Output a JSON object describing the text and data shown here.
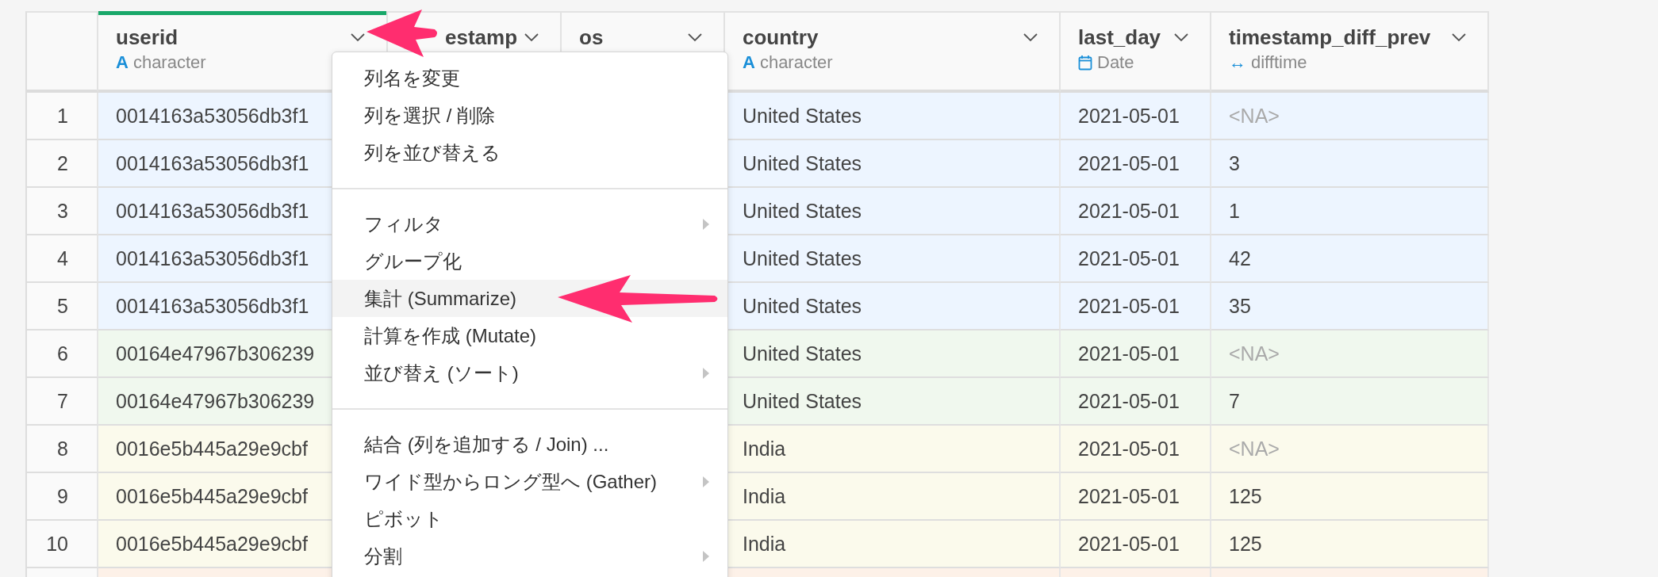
{
  "columns": [
    {
      "name": "userid",
      "selected": true,
      "type": {
        "kind": "char",
        "glyph": "A",
        "label": "character"
      }
    },
    {
      "name": "estamp",
      "selected": false
    },
    {
      "name": "os",
      "selected": false
    },
    {
      "name": "country",
      "selected": false,
      "type": {
        "kind": "char",
        "glyph": "A",
        "label": "character"
      }
    },
    {
      "name": "last_day",
      "selected": false,
      "type": {
        "kind": "date",
        "label": "Date"
      }
    },
    {
      "name": "timestamp_diff_prev",
      "selected": false,
      "type": {
        "kind": "diff",
        "glyph": "↔",
        "label": "difftime"
      }
    }
  ],
  "rows": [
    {
      "number": "1",
      "color": "#edf5ff",
      "cells": [
        {
          "text": "0014163a53056db3f1"
        },
        {},
        {},
        {
          "text": "United States"
        },
        {
          "text": "2021-05-01"
        },
        {
          "text": "<NA>",
          "missing": true
        }
      ]
    },
    {
      "number": "2",
      "color": "#edf5ff",
      "cells": [
        {
          "text": "0014163a53056db3f1"
        },
        {},
        {},
        {
          "text": "United States"
        },
        {
          "text": "2021-05-01"
        },
        {
          "text": "3",
          "missing": false
        }
      ]
    },
    {
      "number": "3",
      "color": "#edf5ff",
      "cells": [
        {
          "text": "0014163a53056db3f1"
        },
        {},
        {},
        {
          "text": "United States"
        },
        {
          "text": "2021-05-01"
        },
        {
          "text": "1",
          "missing": false
        }
      ]
    },
    {
      "number": "4",
      "color": "#edf5ff",
      "cells": [
        {
          "text": "0014163a53056db3f1"
        },
        {},
        {},
        {
          "text": "United States"
        },
        {
          "text": "2021-05-01"
        },
        {
          "text": "42",
          "missing": false
        }
      ]
    },
    {
      "number": "5",
      "color": "#edf5ff",
      "cells": [
        {
          "text": "0014163a53056db3f1"
        },
        {},
        {},
        {
          "text": "United States"
        },
        {
          "text": "2021-05-01"
        },
        {
          "text": "35",
          "missing": false
        }
      ]
    },
    {
      "number": "6",
      "color": "#f0f8ee",
      "cells": [
        {
          "text": "00164e47967b306239"
        },
        {},
        {},
        {
          "text": "United States"
        },
        {
          "text": "2021-05-01"
        },
        {
          "text": "<NA>",
          "missing": true
        }
      ]
    },
    {
      "number": "7",
      "color": "#f0f8ee",
      "cells": [
        {
          "text": "00164e47967b306239"
        },
        {},
        {},
        {
          "text": "United States"
        },
        {
          "text": "2021-05-01"
        },
        {
          "text": "7",
          "missing": false
        }
      ]
    },
    {
      "number": "8",
      "color": "#fbfaec",
      "cells": [
        {
          "text": "0016e5b445a29e9cbf"
        },
        {},
        {},
        {
          "text": "India"
        },
        {
          "text": "2021-05-01"
        },
        {
          "text": "<NA>",
          "missing": true
        }
      ]
    },
    {
      "number": "9",
      "color": "#fbfaec",
      "cells": [
        {
          "text": "0016e5b445a29e9cbf"
        },
        {},
        {},
        {
          "text": "India"
        },
        {
          "text": "2021-05-01"
        },
        {
          "text": "125",
          "missing": false
        }
      ]
    },
    {
      "number": "10",
      "color": "#fbfaec",
      "cells": [
        {
          "text": "0016e5b445a29e9cbf"
        },
        {},
        {},
        {
          "text": "India"
        },
        {
          "text": "2021-05-01"
        },
        {
          "text": "125",
          "missing": false
        }
      ]
    },
    {
      "color": "#fdf1e8",
      "cells": [
        {},
        {},
        {},
        {},
        {},
        {}
      ]
    }
  ],
  "menu": {
    "groups": [
      [
        {
          "label": "列名を変更",
          "submenu": false,
          "highlighted": false
        },
        {
          "label": "列を選択 / 削除",
          "submenu": false,
          "highlighted": false
        },
        {
          "label": "列を並び替える",
          "submenu": false,
          "highlighted": false
        }
      ],
      [
        {
          "label": "フィルタ",
          "submenu": true,
          "highlighted": false
        },
        {
          "label": "グループ化",
          "submenu": false,
          "highlighted": false
        },
        {
          "label": "集計 (Summarize)",
          "submenu": false,
          "highlighted": true
        },
        {
          "label": "計算を作成 (Mutate)",
          "submenu": false,
          "highlighted": false
        },
        {
          "label": "並び替え (ソート)",
          "submenu": true,
          "highlighted": false
        }
      ],
      [
        {
          "label": "結合 (列を追加する / Join) ...",
          "submenu": false,
          "highlighted": false
        },
        {
          "label": "ワイド型からロング型へ (Gather)",
          "submenu": true,
          "highlighted": false
        },
        {
          "label": "ピボット",
          "submenu": false,
          "highlighted": false
        },
        {
          "label": "分割",
          "submenu": true,
          "highlighted": false
        }
      ]
    ]
  }
}
